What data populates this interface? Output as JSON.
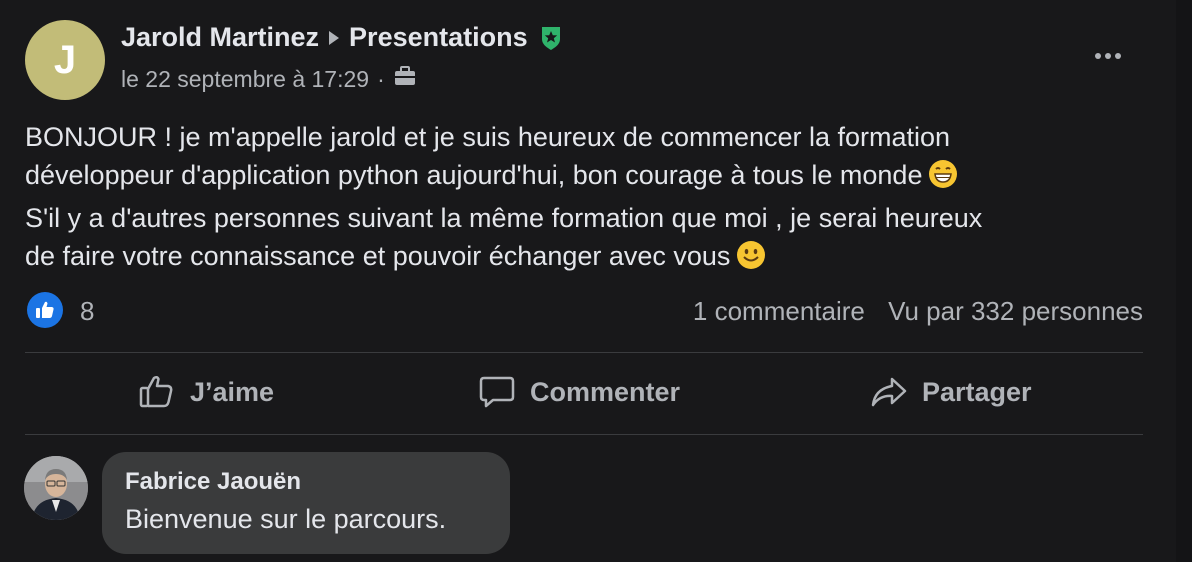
{
  "post": {
    "author": "Jarold Martinez",
    "group": "Presentations",
    "avatar_initial": "J",
    "timestamp": "le 22 septembre à 17:29",
    "meta_separator": "·",
    "body_lines": [
      "BONJOUR ! je m'appelle jarold et je suis heureux de commencer la formation",
      "développeur d'application python aujourd'hui, bon courage à tous le monde",
      "S'il y a d'autres personnes suivant la même formation que moi , je serai heureux",
      "de faire votre connaissance et pouvoir échanger avec vous"
    ]
  },
  "stats": {
    "reaction_count": "8",
    "comments": "1 commentaire",
    "views": "Vu par 332 personnes"
  },
  "actions": {
    "like": "J’aime",
    "comment": "Commenter",
    "share": "Partager"
  },
  "comment": {
    "author": "Fabrice Jaouën",
    "text": "Bienvenue sur le parcours."
  },
  "colors": {
    "background": "#18181a",
    "text_primary": "#e4e6eb",
    "text_secondary": "#b0b3b8",
    "like_blue": "#1b74e4",
    "badge_green": "#2fb36b",
    "avatar_olive": "#c2bc78",
    "comment_bubble": "#3a3b3c"
  },
  "icons": {
    "group_arrow": "triangle-right-icon",
    "admin_badge": "shield-star-icon",
    "audience": "briefcase-icon",
    "more": "more-dots-icon",
    "reaction": "thumbs-up-icon",
    "emoji_1": "grinning-emoji-icon",
    "emoji_2": "smiling-emoji-icon"
  }
}
